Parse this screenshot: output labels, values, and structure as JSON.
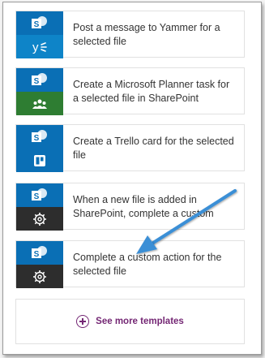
{
  "templates": [
    {
      "label": "Post a message to Yammer for a selected file",
      "service_icon": "yammer-icon",
      "service_color": "#0e84c8"
    },
    {
      "label": "Create a Microsoft Planner task for a selected file in SharePoint",
      "service_icon": "planner-icon",
      "service_color": "#2e7d32"
    },
    {
      "label": "Create a Trello card for the selected file",
      "service_icon": "trello-icon",
      "service_color": "#0a6fb5"
    },
    {
      "label": "When a new file is added in SharePoint, complete a custom",
      "service_icon": "gear-icon",
      "service_color": "#2d2d2d"
    },
    {
      "label": "Complete a custom action for the selected file",
      "service_icon": "gear-icon",
      "service_color": "#2d2d2d"
    }
  ],
  "see_more": {
    "label": "See more templates"
  },
  "colors": {
    "sharepoint": "#0a6fb5",
    "accent": "#742774",
    "arrow": "#3b8fd6"
  }
}
